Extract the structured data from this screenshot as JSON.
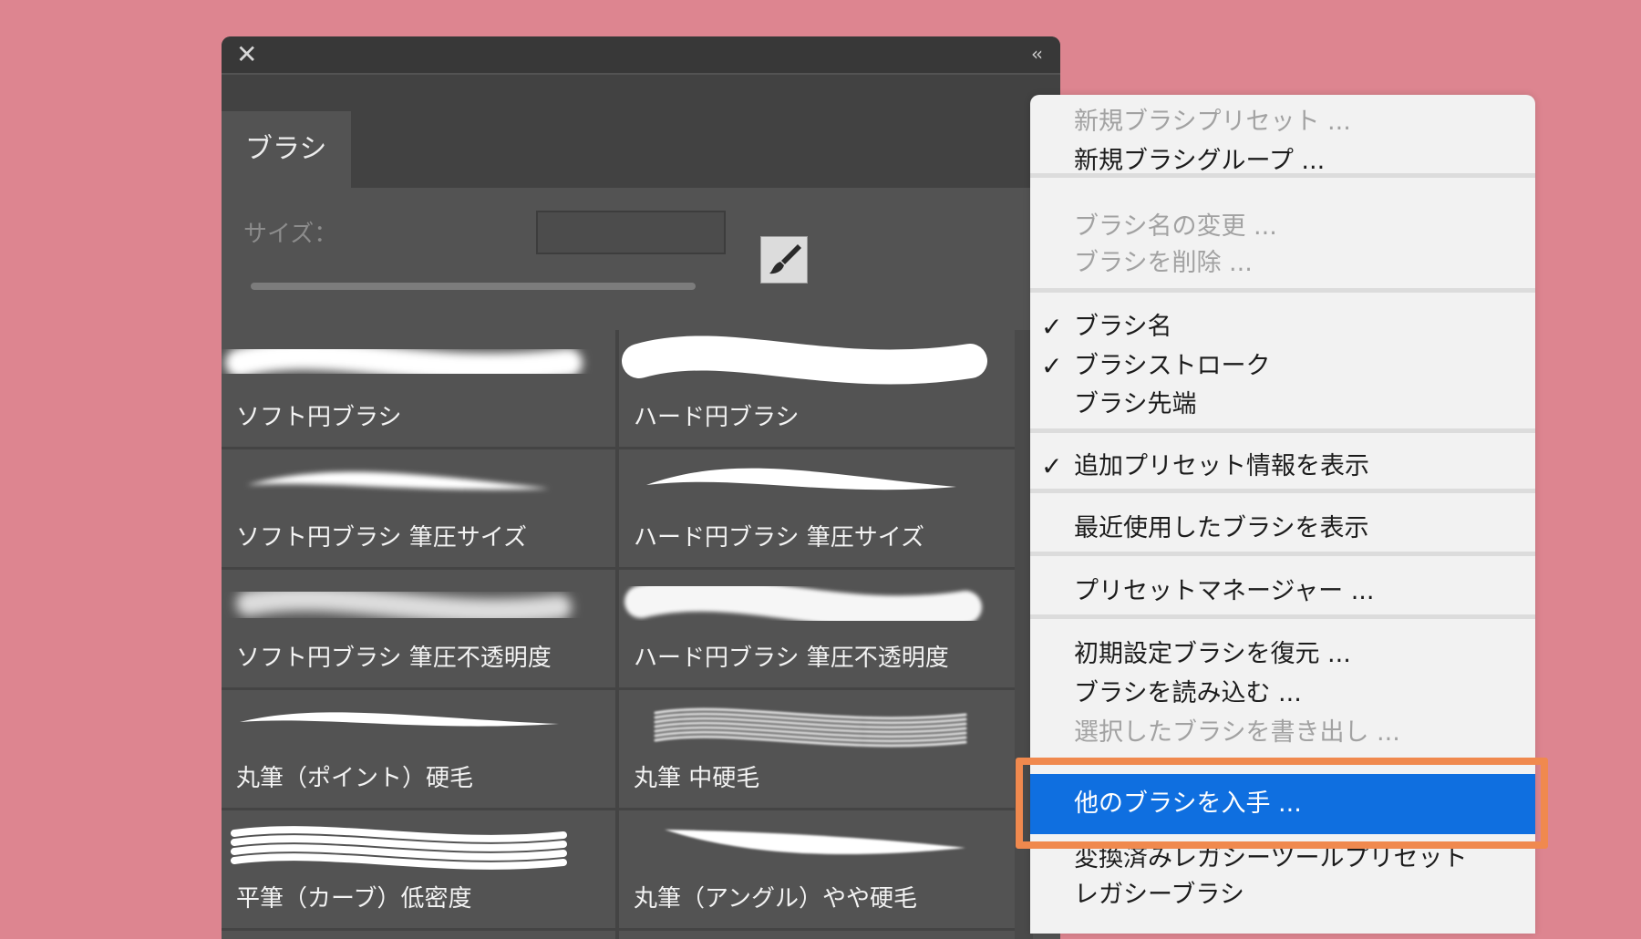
{
  "panel": {
    "close_glyph": "✕",
    "collapse_glyph": "‹‹",
    "tab_label": "ブラシ",
    "size_label": "サイズ：",
    "size_value": ""
  },
  "brushes": [
    {
      "label": "ソフト円ブラシ",
      "style": "soft"
    },
    {
      "label": "ハード円ブラシ",
      "style": "hard"
    },
    {
      "label": "ソフト円ブラシ 筆圧サイズ",
      "style": "soft-taper"
    },
    {
      "label": "ハード円ブラシ 筆圧サイズ",
      "style": "hard-taper"
    },
    {
      "label": "ソフト円ブラシ 筆圧不透明度",
      "style": "soft-opacity"
    },
    {
      "label": "ハード円ブラシ 筆圧不透明度",
      "style": "hard-opacity"
    },
    {
      "label": "丸筆（ポイント）硬毛",
      "style": "point"
    },
    {
      "label": "丸筆 中硬毛",
      "style": "bristle"
    },
    {
      "label": "平筆（カーブ）低密度",
      "style": "flat-curve"
    },
    {
      "label": "丸筆（アングル）やや硬毛",
      "style": "angle"
    }
  ],
  "menu": {
    "items": [
      {
        "label": "新規ブラシプリセット ...",
        "disabled": true,
        "checked": false
      },
      {
        "label": "新規ブラシグループ ...",
        "disabled": false,
        "checked": false
      },
      {
        "label": "ブラシ名の変更 ...",
        "disabled": true,
        "checked": false
      },
      {
        "label": "ブラシを削除 ...",
        "disabled": true,
        "checked": false
      },
      {
        "label": "ブラシ名",
        "disabled": false,
        "checked": true
      },
      {
        "label": "ブラシストローク",
        "disabled": false,
        "checked": true
      },
      {
        "label": "ブラシ先端",
        "disabled": false,
        "checked": false
      },
      {
        "label": "追加プリセット情報を表示",
        "disabled": false,
        "checked": true
      },
      {
        "label": "最近使用したブラシを表示",
        "disabled": false,
        "checked": false
      },
      {
        "label": "プリセットマネージャー ...",
        "disabled": false,
        "checked": false
      },
      {
        "label": "初期設定ブラシを復元 ...",
        "disabled": false,
        "checked": false
      },
      {
        "label": "ブラシを読み込む ...",
        "disabled": false,
        "checked": false
      },
      {
        "label": "選択したブラシを書き出し ...",
        "disabled": true,
        "checked": false
      },
      {
        "label": "他のブラシを入手 ...",
        "disabled": false,
        "checked": false,
        "highlighted": true
      },
      {
        "label": "変換済みレガシーツールプリセット",
        "disabled": false,
        "checked": false
      },
      {
        "label": "レガシーブラシ",
        "disabled": false,
        "checked": false
      }
    ],
    "check_glyph": "✓"
  },
  "colors": {
    "background": "#dd8590",
    "panel": "#535353",
    "highlight": "#0f6fe0",
    "highlight_frame": "#f0894e"
  }
}
